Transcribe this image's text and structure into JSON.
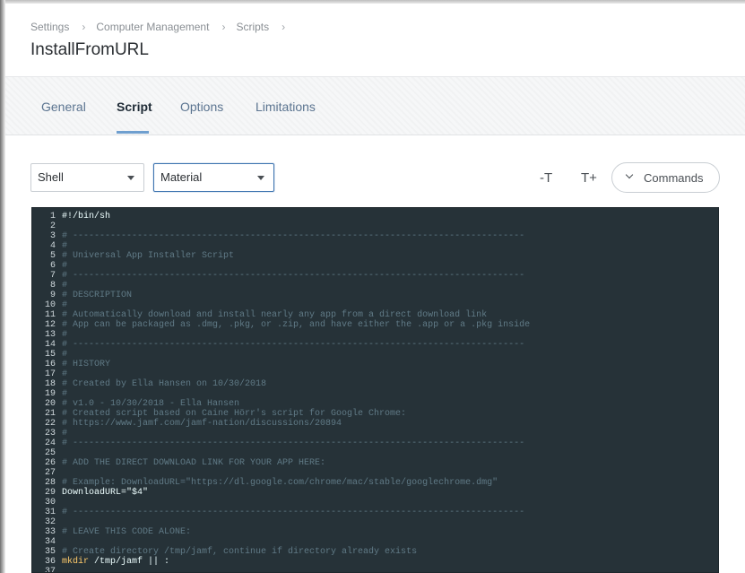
{
  "breadcrumb": [
    "Settings",
    "Computer Management",
    "Scripts"
  ],
  "page_title": "InstallFromURL",
  "tabs": [
    {
      "label": "General",
      "active": false
    },
    {
      "label": "Script",
      "active": true
    },
    {
      "label": "Options",
      "active": false
    },
    {
      "label": "Limitations",
      "active": false
    }
  ],
  "toolbar": {
    "language_select": "Shell",
    "theme_select": "Material",
    "decrease_font_label": "-T",
    "increase_font_label": "T+",
    "commands_label": "Commands"
  },
  "colors": {
    "editor_bg": "#263238",
    "comment": "#607a86",
    "keyword": "#ffcb6b",
    "tab_link": "#5b7490",
    "focus_border": "#3e74b0"
  },
  "code_lines": [
    {
      "n": "1",
      "t": "#!/bin/sh",
      "k": "plain"
    },
    {
      "n": "2",
      "t": "",
      "k": "plain"
    },
    {
      "n": "3",
      "t": "# ------------------------------------------------------------------------------------",
      "k": "comment"
    },
    {
      "n": "4",
      "t": "#",
      "k": "comment"
    },
    {
      "n": "5",
      "t": "# Universal App Installer Script",
      "k": "comment"
    },
    {
      "n": "6",
      "t": "#",
      "k": "comment"
    },
    {
      "n": "7",
      "t": "# ------------------------------------------------------------------------------------",
      "k": "comment"
    },
    {
      "n": "8",
      "t": "#",
      "k": "comment"
    },
    {
      "n": "9",
      "t": "# DESCRIPTION",
      "k": "comment"
    },
    {
      "n": "10",
      "t": "#",
      "k": "comment"
    },
    {
      "n": "11",
      "t": "# Automatically download and install nearly any app from a direct download link",
      "k": "comment"
    },
    {
      "n": "12",
      "t": "# App can be packaged as .dmg, .pkg, or .zip, and have either the .app or a .pkg inside",
      "k": "comment"
    },
    {
      "n": "13",
      "t": "#",
      "k": "comment"
    },
    {
      "n": "14",
      "t": "# ------------------------------------------------------------------------------------",
      "k": "comment"
    },
    {
      "n": "15",
      "t": "#",
      "k": "comment"
    },
    {
      "n": "16",
      "t": "# HISTORY",
      "k": "comment"
    },
    {
      "n": "17",
      "t": "#",
      "k": "comment"
    },
    {
      "n": "18",
      "t": "# Created by Ella Hansen on 10/30/2018",
      "k": "comment"
    },
    {
      "n": "19",
      "t": "#",
      "k": "comment"
    },
    {
      "n": "20",
      "t": "# v1.0 - 10/30/2018 - Ella Hansen",
      "k": "comment"
    },
    {
      "n": "21",
      "t": "# Created script based on Caine Hörr's script for Google Chrome:",
      "k": "comment"
    },
    {
      "n": "22",
      "t": "# https://www.jamf.com/jamf-nation/discussions/20894",
      "k": "comment"
    },
    {
      "n": "23",
      "t": "#",
      "k": "comment"
    },
    {
      "n": "24",
      "t": "# ------------------------------------------------------------------------------------",
      "k": "comment"
    },
    {
      "n": "25",
      "t": "",
      "k": "plain"
    },
    {
      "n": "26",
      "t": "# ADD THE DIRECT DOWNLOAD LINK FOR YOUR APP HERE:",
      "k": "comment"
    },
    {
      "n": "27",
      "t": "",
      "k": "plain"
    },
    {
      "n": "28",
      "t": "# Example: DownloadURL=\"https://dl.google.com/chrome/mac/stable/googlechrome.dmg\"",
      "k": "comment"
    },
    {
      "n": "29",
      "t": "DownloadURL=\"$4\"",
      "k": "plain"
    },
    {
      "n": "30",
      "t": "",
      "k": "plain"
    },
    {
      "n": "31",
      "t": "# ------------------------------------------------------------------------------------",
      "k": "comment"
    },
    {
      "n": "32",
      "t": "",
      "k": "plain"
    },
    {
      "n": "33",
      "t": "# LEAVE THIS CODE ALONE:",
      "k": "comment"
    },
    {
      "n": "34",
      "t": "",
      "k": "plain"
    },
    {
      "n": "35",
      "t": "# Create directory /tmp/jamf, continue if directory already exists",
      "k": "comment"
    },
    {
      "n": "36",
      "t": "mkdir /tmp/jamf || :",
      "k": "mixed",
      "kw": "mkdir",
      "rest": " /tmp/jamf || :"
    },
    {
      "n": "37",
      "t": "",
      "k": "plain"
    }
  ]
}
